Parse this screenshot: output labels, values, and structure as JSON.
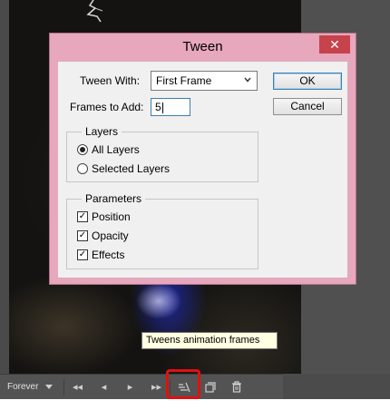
{
  "dialog": {
    "title": "Tween",
    "close_glyph": "✕",
    "tween_with_label": "Tween With:",
    "tween_with_value": "First Frame",
    "frames_label": "Frames to Add:",
    "frames_value": "5",
    "ok_label": "OK",
    "cancel_label": "Cancel",
    "layers": {
      "title": "Layers",
      "options": [
        {
          "label": "All Layers",
          "selected": true
        },
        {
          "label": "Selected Layers",
          "selected": false
        }
      ]
    },
    "parameters": {
      "title": "Parameters",
      "options": [
        {
          "label": "Position",
          "checked": true
        },
        {
          "label": "Opacity",
          "checked": true
        },
        {
          "label": "Effects",
          "checked": true
        }
      ]
    }
  },
  "tooltip": {
    "text": "Tweens animation frames"
  },
  "timeline": {
    "loop_label": "Forever",
    "buttons": [
      "◂◂",
      "◂",
      "▸",
      "▸▸"
    ]
  },
  "colors": {
    "titlebar": "#e7a7bc",
    "close": "#c7434c",
    "highlight": "#e01010",
    "tooltip_bg": "#ffffe1"
  }
}
